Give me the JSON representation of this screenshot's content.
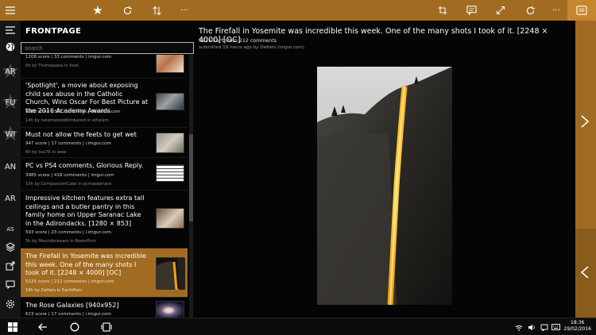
{
  "panel": {
    "title": "FRONTPAGE",
    "search_placeholder": "search"
  },
  "rail": {
    "items": [
      "AR",
      "FU",
      "WI",
      "AN",
      "AR",
      "AS"
    ]
  },
  "posts": [
    {
      "title": "",
      "meta": "1208 score | 33 comments | imgur.com",
      "sub": "5h by Thomasasia in food"
    },
    {
      "title": "'Spotlight', a movie about exposing child sex abuse in the Catholic Church, Wins Oscar For Best Picture at the 2016 Academy Awards",
      "meta": "4380 score | 337 comments | deadline.com",
      "sub": "14h by helpmeredditimbored in atheism"
    },
    {
      "title": "Must not allow the feets to get wet",
      "meta": "947 score | 17 comments | i.imgur.com",
      "sub": "6h by Isai76 in aww"
    },
    {
      "title": "PC vs PS4 comments, Glorious Reply.",
      "meta": "3985 score | 418 comments | imgur.com",
      "sub": "10h by CompassionCube in pcmasterrace"
    },
    {
      "title": "Impressive kitchen features extra tall ceilings and a butler pantry in this family home on Upper Saranac Lake in the Adirondacks. [1280 × 853]",
      "meta": "593 score | 23 comments | i.imgur.com",
      "sub": "5h by Meunderwears in RoomPorn"
    },
    {
      "title": "The Firefall in Yosemite was incredible this week. One of the many shots I took of it. [2248 × 4000] [OC]",
      "meta": "5225 score | 212 comments | imgur.com",
      "sub": "18h by Defiets in EarthPorn"
    },
    {
      "title": "The Rose Galaxies [940x952]",
      "meta": "623 score | 17 comments | i.imgur.com",
      "sub": ""
    }
  ],
  "main": {
    "title": "The Firefall in Yosemite was incredible this week. One of the many shots I took of it. [2248 × 4000] [OC]",
    "stats": "5225  EarthPorn  212 comments",
    "submitted": "submitted 18 hours ago by Defiets  (imgur.com)"
  },
  "clock": {
    "time": "18:36",
    "date": "29/02/2016"
  },
  "colors": {
    "accent": "#a16c22",
    "accent_light": "#c6862e",
    "selection": "#a16c22"
  }
}
